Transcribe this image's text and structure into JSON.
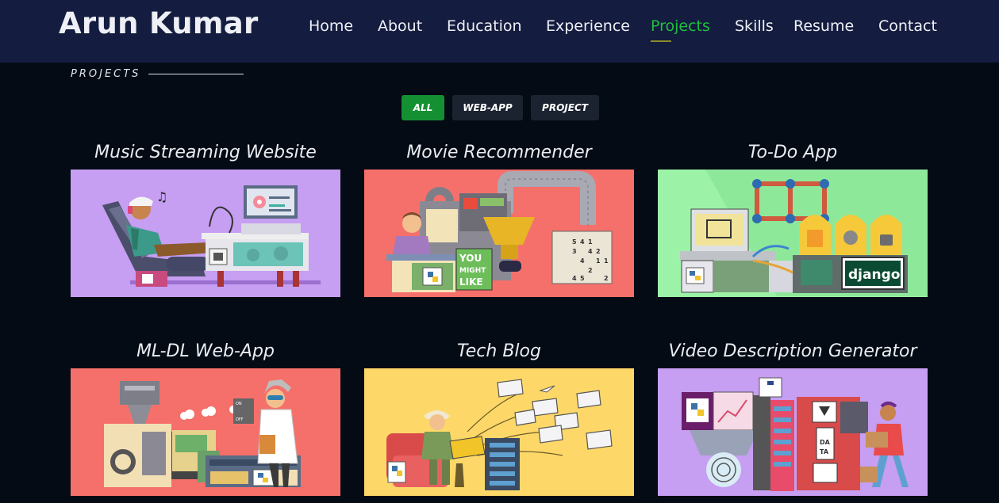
{
  "header": {
    "logo": "Arun Kumar",
    "nav": [
      {
        "label": "Home",
        "active": false
      },
      {
        "label": "About",
        "active": false
      },
      {
        "label": "Education",
        "active": false
      },
      {
        "label": "Experience",
        "active": false
      },
      {
        "label": "Projects",
        "active": true
      },
      {
        "label": "Skills",
        "active": false
      },
      {
        "label": "Resume",
        "active": false
      },
      {
        "label": "Contact",
        "active": false
      }
    ]
  },
  "section": {
    "title": "PROJECTS"
  },
  "filters": [
    {
      "label": "ALL",
      "active": true
    },
    {
      "label": "WEB-APP",
      "active": false
    },
    {
      "label": "PROJECT",
      "active": false
    }
  ],
  "projects": [
    {
      "title": "Music Streaming Website",
      "bg": "#c69ef2"
    },
    {
      "title": "Movie Recommender",
      "bg": "#f5706a"
    },
    {
      "title": "To-Do App",
      "bg": "#9cf3a8",
      "badge": "django"
    },
    {
      "title": "ML-DL Web-App",
      "bg": "#f5706a"
    },
    {
      "title": "Tech Blog",
      "bg": "#fdd868"
    },
    {
      "title": "Video Description Generator",
      "bg": "#c69ef2"
    }
  ],
  "illustration_text": {
    "movie": [
      "YOU",
      "MIGHT",
      "LIKE"
    ],
    "sudoku": [
      "5",
      "4",
      "1",
      "3",
      "4",
      "2",
      "4",
      "1",
      "1",
      "2",
      "4",
      "5",
      "2"
    ],
    "mldl": [
      "ON",
      "OFF"
    ],
    "video": [
      "DA",
      "TA"
    ]
  }
}
